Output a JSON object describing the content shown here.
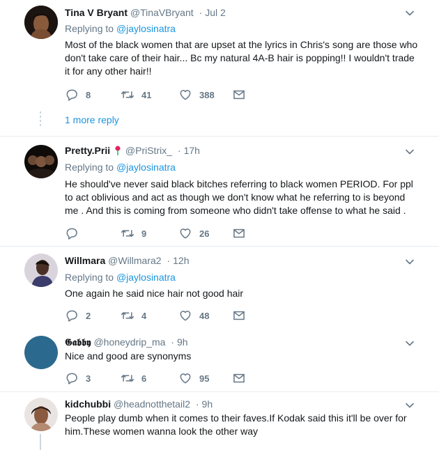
{
  "tweets": [
    {
      "name": "Tina V Bryant",
      "handle": "@TinaVBryant",
      "time": "Jul 2",
      "replying_prefix": "Replying to",
      "replying_to": "@jaylosinatra",
      "text": "Most of the black women that are upset at the lyrics in Chris's song are those who don't take care of their hair... Bc my natural 4A-B hair is popping!! I wouldn't trade it for any other hair!!",
      "replies": "8",
      "retweets": "41",
      "likes": "388",
      "more_replies": "1 more reply"
    },
    {
      "name": "Pretty.Prii",
      "handle": "@PriStrix_",
      "time": "17h",
      "replying_prefix": "Replying to",
      "replying_to": "@jaylosinatra",
      "text": "He should've never said black bitches referring to black women PERIOD. For ppl to act oblivious and act as though we don't know what he referring to is beyond me . And this is coming from someone who didn't take offense to what he said .",
      "replies": "",
      "retweets": "9",
      "likes": "26"
    },
    {
      "name": "Willmara",
      "handle": "@Willmara2",
      "time": "12h",
      "replying_prefix": "Replying to",
      "replying_to": "@jaylosinatra",
      "text": "One again he said nice hair not good hair",
      "replies": "2",
      "retweets": "4",
      "likes": "48"
    },
    {
      "name": "𝕲𝖆𝖇𝖇𝖞",
      "handle": "@honeydrip_ma",
      "time": "9h",
      "text": "Nice and good are synonyms",
      "replies": "3",
      "retweets": "6",
      "likes": "95"
    },
    {
      "name": "kidchubbi",
      "handle": "@headnotthetail2",
      "time": "9h",
      "text": "People play dumb when it comes to their faves.If Kodak said this it'll be over for him.These women wanna look the other way"
    }
  ],
  "colors": {
    "link": "#1b95e0",
    "muted": "#657786",
    "divider": "#e6ecf0",
    "avatar_blue": "#2b6a8e"
  }
}
